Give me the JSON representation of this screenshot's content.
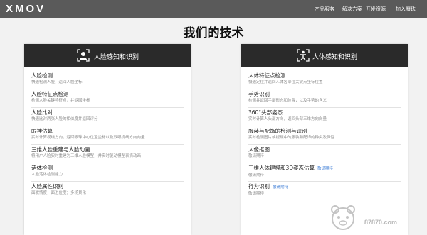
{
  "header": {
    "logo": "XMOV",
    "nav": [
      "产品服务",
      "解决方案",
      "开发资源",
      "加入魔珐"
    ]
  },
  "page": {
    "title": "我们的技术"
  },
  "left_card": {
    "title": "人脸感知和识别",
    "items": [
      {
        "title": "人脸检测",
        "desc": "快速检测人脸，返回人脸坐标"
      },
      {
        "title": "人脸特征点检测",
        "desc": "检测人脸关键特征点，并返回坐标"
      },
      {
        "title": "人脸比对",
        "desc": "快速比对两张人脸的相似度并返回评分"
      },
      {
        "title": "眼神估算",
        "desc": "实时计算视线方向，返回眼球中心位置坐标以及双眼视线方向向量"
      },
      {
        "title": "三维人脸重建与人脸动画",
        "desc": "将用户人脸实时重建为三维人脸模型，并实时驱动模型表情动画"
      },
      {
        "title": "活体检测",
        "desc": "人脸活体检测能力"
      },
      {
        "title": "人脸属性识别",
        "desc": "面貌情度；面进位度；多场景化"
      }
    ]
  },
  "right_card": {
    "title": "人体感知和识别",
    "items": [
      {
        "title": "人体特征点检测",
        "desc": "快速定位并返回人体各部位关键点坐标位置"
      },
      {
        "title": "手势识别",
        "desc": "检测并返回手部形态和位置，以及手势的含义"
      },
      {
        "title": "360°头部姿态",
        "desc": "实时计算人头部方向，返回头部三维方向向量"
      },
      {
        "title": "服装与配饰的检测与识别",
        "desc": "实时检测图片或视频中的服装和配饰的种类及属性"
      },
      {
        "title": "人像抠图",
        "desc": "敬请期待"
      },
      {
        "title": "三维人体建模和3D姿态估算",
        "tag": "敬请期待",
        "desc": "敬请期待"
      },
      {
        "title": "行为识别",
        "tag": "敬请期待",
        "desc": "敬请期待"
      }
    ]
  },
  "watermark": {
    "text": "87870.com"
  }
}
